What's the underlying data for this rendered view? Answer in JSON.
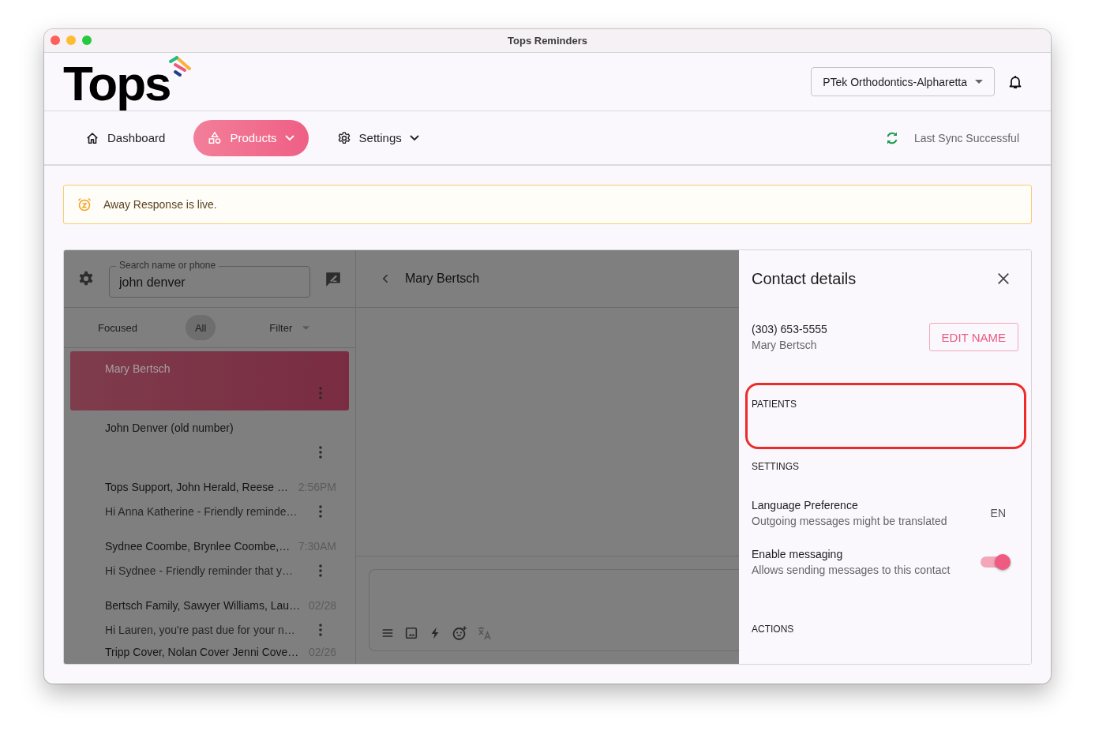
{
  "window": {
    "title": "Tops Reminders"
  },
  "header": {
    "logo": "Tops",
    "location": "PTek Orthodontics-Alpharetta"
  },
  "nav": [
    {
      "label": "Dashboard",
      "kind": "home",
      "selected": false,
      "caret": false
    },
    {
      "label": "Products",
      "kind": "products",
      "selected": true,
      "caret": true
    },
    {
      "label": "Settings",
      "kind": "settings",
      "selected": false,
      "caret": true
    }
  ],
  "sync_status": "Last Sync Successful",
  "banner": {
    "text": "Away Response is live."
  },
  "conversations_panel": {
    "search": {
      "label": "Search name or phone",
      "value": "john denver"
    },
    "filters": [
      {
        "label": "Focused",
        "selected": false
      },
      {
        "label": "All",
        "selected": true
      }
    ],
    "filter_menu": "Filter",
    "conversations": [
      {
        "title": "Mary Bertsch",
        "selected": true
      },
      {
        "title": "John Denver (old number)",
        "selected": false
      },
      {
        "title": "Tops Support, John Herald, Reese …",
        "time": "2:56PM",
        "preview": "Hi Anna Katherine - Friendly reminde…",
        "selected": false
      },
      {
        "title": "Sydnee Coombe, Brynlee Coombe,…",
        "time": "7:30AM",
        "preview": "Hi Sydnee - Friendly reminder that y…",
        "selected": false
      },
      {
        "title": "Bertsch Family, Sawyer Williams, Lau…",
        "time": "02/28",
        "preview": "Hi Lauren, you're past due for your n…",
        "selected": false
      },
      {
        "title": "Tripp Cover, Nolan Cover Jenni Cove…",
        "time": "02/26",
        "selected": false
      }
    ]
  },
  "chat": {
    "contact": "Mary Bertsch"
  },
  "contact_details": {
    "title": "Contact details",
    "phone": "(303) 653-5555",
    "name": "Mary Bertsch",
    "edit_button": "EDIT NAME",
    "patients": {
      "heading": "PATIENTS",
      "highlighted": true
    },
    "settings": {
      "heading": "SETTINGS",
      "items": [
        {
          "kind": "value",
          "label": "Language Preference",
          "description": "Outgoing messages might be translated",
          "value": "EN"
        },
        {
          "kind": "toggle",
          "label": "Enable messaging",
          "description": "Allows sending messages to this contact",
          "on": true
        }
      ]
    },
    "actions": {
      "heading": "ACTIONS"
    }
  }
}
